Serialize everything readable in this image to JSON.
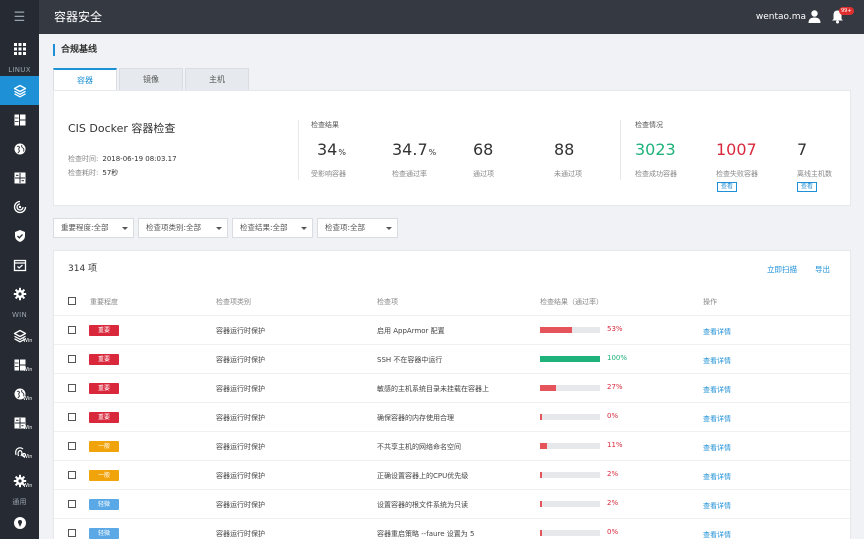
{
  "header": {
    "title": "容器安全",
    "user": "wentao.ma",
    "badge": "99+"
  },
  "sidebar": {
    "sections": [
      "LINUX",
      "WIN",
      "通用"
    ],
    "linux_items": [
      "apps-grid-icon",
      "layers-icon",
      "bento-icon",
      "globe-icon",
      "dashboard-icon",
      "radar-icon",
      "shield-check-icon",
      "calendar-check-icon",
      "gear-icon"
    ],
    "win_items": [
      "layers-icon",
      "bento-icon",
      "globe-icon",
      "dashboard-icon",
      "fingerprint-icon",
      "gear-icon"
    ],
    "win_tag": "Win"
  },
  "page": {
    "title": "合规基线",
    "tabs": [
      "容器",
      "镜像",
      "主机"
    ]
  },
  "summary": {
    "title": "CIS Docker 容器检查",
    "time_label": "检查时间:",
    "time_value": "2018-06-19 08:03.17",
    "duration_label": "检查耗时:",
    "duration_value": "57秒",
    "result_label": "检查结果",
    "results": [
      {
        "value": "34",
        "unit": "%",
        "label": "受影响容器"
      },
      {
        "value": "34.7",
        "unit": "%",
        "label": "检查通过率"
      },
      {
        "value": "68",
        "unit": "",
        "label": "通过项"
      },
      {
        "value": "88",
        "unit": "",
        "label": "未通过项"
      }
    ],
    "status_label": "检查情况",
    "status": [
      {
        "value": "3023",
        "label": "检查成功容器",
        "color": "#1fb27a",
        "link": ""
      },
      {
        "value": "1007",
        "label": "检查失败容器",
        "color": "#d9283c",
        "link": "查看"
      },
      {
        "value": "7",
        "label": "离线主机数",
        "color": "#333333",
        "link": "查看"
      }
    ]
  },
  "filters": [
    {
      "label": "重要程度:",
      "value": "全部"
    },
    {
      "label": "检查项类别:",
      "value": "全部"
    },
    {
      "label": "检查结果:",
      "value": "全部"
    },
    {
      "label": "检查项:",
      "value": "全部"
    }
  ],
  "table": {
    "count": "314 项",
    "actions": {
      "scan": "立即扫描",
      "export": "导出"
    },
    "headers": [
      "重要程度",
      "检查项类别",
      "检查项",
      "检查结果（通过率）",
      "操作"
    ],
    "detail_label": "查看详情",
    "rows": [
      {
        "severity": "重要",
        "sev_color": "#d9283c",
        "category": "容器运行时保护",
        "item": "启用 AppArmor 配置",
        "pass_rate": 53,
        "pct": "53%",
        "bar_color": "#e5545a",
        "pct_color": "#d9283c"
      },
      {
        "severity": "重要",
        "sev_color": "#d9283c",
        "category": "容器运行时保护",
        "item": "SSH 不在容器中运行",
        "pass_rate": 100,
        "pct": "100%",
        "bar_color": "#1fb27a",
        "pct_color": "#1fb27a"
      },
      {
        "severity": "重要",
        "sev_color": "#d9283c",
        "category": "容器运行时保护",
        "item": "敏感的主机系统目录未挂载在容器上",
        "pass_rate": 27,
        "pct": "27%",
        "bar_color": "#e5545a",
        "pct_color": "#d9283c"
      },
      {
        "severity": "重要",
        "sev_color": "#d9283c",
        "category": "容器运行时保护",
        "item": "确保容器的内存使用合理",
        "pass_rate": 0,
        "pct": "0%",
        "bar_color": "#e5545a",
        "pct_color": "#d9283c"
      },
      {
        "severity": "一般",
        "sev_color": "#f0a30a",
        "category": "容器运行时保护",
        "item": "不共享主机的网络命名空间",
        "pass_rate": 11,
        "pct": "11%",
        "bar_color": "#e5545a",
        "pct_color": "#d9283c"
      },
      {
        "severity": "一般",
        "sev_color": "#f0a30a",
        "category": "容器运行时保护",
        "item": "正确设置容器上的CPU优先级",
        "pass_rate": 2,
        "pct": "2%",
        "bar_color": "#e5545a",
        "pct_color": "#d9283c"
      },
      {
        "severity": "轻微",
        "sev_color": "#5aa9e6",
        "category": "容器运行时保护",
        "item": "设置容器的根文件系统为只读",
        "pass_rate": 2,
        "pct": "2%",
        "bar_color": "#e5545a",
        "pct_color": "#d9283c"
      },
      {
        "severity": "轻微",
        "sev_color": "#5aa9e6",
        "category": "容器运行时保护",
        "item": "容器重启策略 --faure 设置为 5",
        "pass_rate": 0,
        "pct": "0%",
        "bar_color": "#e5545a",
        "pct_color": "#d9283c"
      }
    ]
  }
}
